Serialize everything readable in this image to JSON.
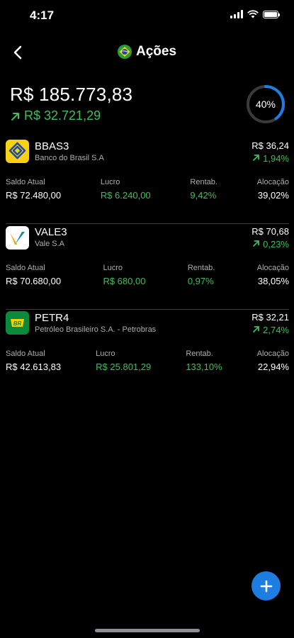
{
  "status_bar": {
    "time": "4:17"
  },
  "nav": {
    "title": "Ações",
    "flag_icon": "brazil-flag-icon"
  },
  "summary": {
    "total": "R$ 185.773,83",
    "gain": "R$ 32.721,29",
    "progress_label": "40%",
    "progress_fraction": 0.4
  },
  "colors": {
    "positive": "#3fbe5a",
    "accent": "#1e7de0",
    "ring_track": "#3a3a3c"
  },
  "holdings": [
    {
      "ticker": "BBAS3",
      "company": "Banco do Brasil S.A",
      "price": "R$ 36,24",
      "change": "1,94%",
      "saldo_label": "Saldo Atual",
      "saldo": "R$ 72.480,00",
      "lucro_label": "Lucro",
      "lucro": "R$ 6.240,00",
      "rentab_label": "Rentab.",
      "rentab": "9,42%",
      "aloc_label": "Alocação",
      "aloc": "39,02%"
    },
    {
      "ticker": "VALE3",
      "company": "Vale S.A",
      "price": "R$ 70,68",
      "change": "0,23%",
      "saldo_label": "Saldo Atual",
      "saldo": "R$ 70.680,00",
      "lucro_label": "Lucro",
      "lucro": "R$ 680,00",
      "rentab_label": "Rentab.",
      "rentab": "0,97%",
      "aloc_label": "Alocação",
      "aloc": "38,05%"
    },
    {
      "ticker": "PETR4",
      "company": "Petróleo Brasileiro S.A. - Petrobras",
      "price": "R$ 32,21",
      "change": "2,74%",
      "saldo_label": "Saldo Atual",
      "saldo": "R$ 42.613,83",
      "lucro_label": "Lucro",
      "lucro": "R$ 25.801,29",
      "rentab_label": "Rentab.",
      "rentab": "133,10%",
      "aloc_label": "Alocação",
      "aloc": "22,94%"
    }
  ]
}
